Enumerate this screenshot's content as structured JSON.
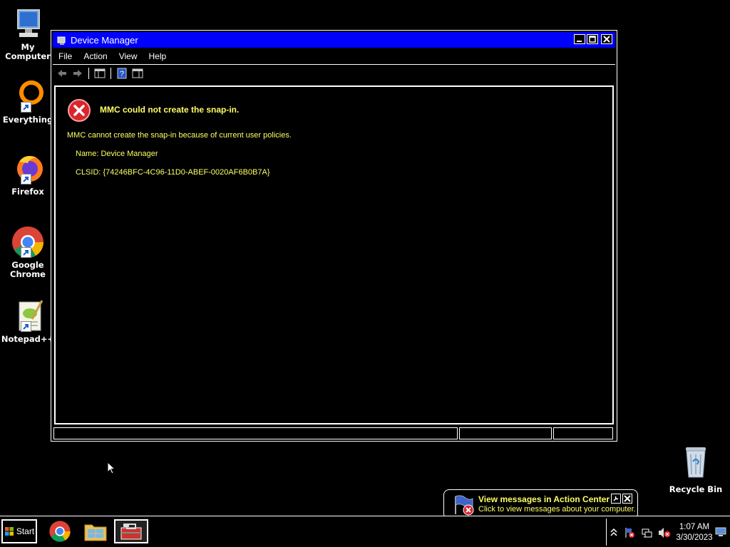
{
  "desktop": {
    "icons": [
      {
        "label": "My Computer"
      },
      {
        "label": "Everything"
      },
      {
        "label": "Firefox"
      },
      {
        "label": "Google Chrome"
      },
      {
        "label": "Notepad++"
      }
    ],
    "recycle_bin": {
      "label": "Recycle Bin"
    }
  },
  "window": {
    "title": "Device Manager",
    "menu": [
      "File",
      "Action",
      "View",
      "Help"
    ],
    "error": {
      "title": "MMC could not create the snap-in.",
      "message": "MMC cannot create the snap-in because of current user policies.",
      "name": "Name: Device Manager",
      "clsid": "CLSID: {74246BFC-4C96-11D0-ABEF-0020AF6B0B7A}"
    }
  },
  "balloon": {
    "title": "View messages in Action Center",
    "text": "Click to view messages about your computer."
  },
  "taskbar": {
    "start_label": "Start",
    "clock_time": "1:07 AM",
    "clock_date": "3/30/2023"
  },
  "colors": {
    "title_bar": "#0000ff",
    "highlight_text": "#ffff66",
    "error_red": "#d9262c"
  }
}
